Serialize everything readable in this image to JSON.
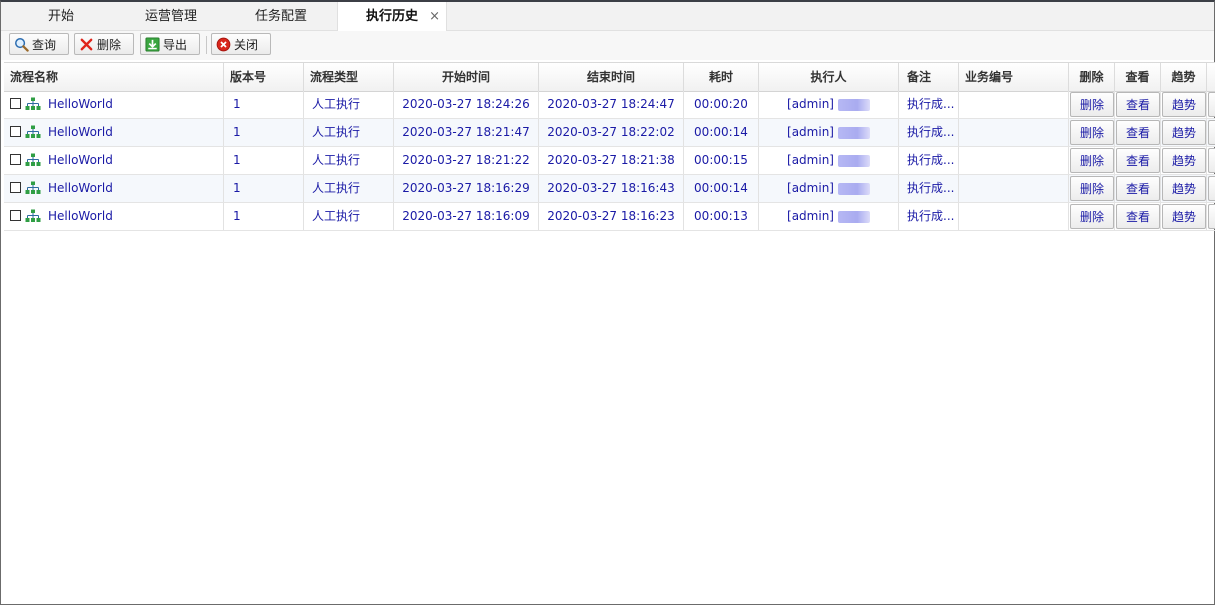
{
  "tabs": [
    {
      "label": "开始"
    },
    {
      "label": "运营管理"
    },
    {
      "label": "任务配置"
    },
    {
      "label": "执行历史",
      "close": "×"
    }
  ],
  "toolbar": {
    "query": "查询",
    "delete": "删除",
    "export": "导出",
    "close": "关闭"
  },
  "columns": {
    "name": "流程名称",
    "version": "版本号",
    "type": "流程类型",
    "start": "开始时间",
    "end": "结束时间",
    "duration": "耗时",
    "executor": "执行人",
    "remark": "备注",
    "bizno": "业务编号",
    "delete": "删除",
    "view": "查看",
    "trend": "趋势"
  },
  "rows": [
    {
      "name": "HelloWorld",
      "version": "1",
      "type": "人工执行",
      "start": "2020-03-27 18:24:26",
      "end": "2020-03-27 18:24:47",
      "duration": "00:00:20",
      "executor": "[admin]",
      "remark": "执行成...",
      "bizno": "",
      "delete": "删除",
      "view": "查看",
      "trend": "趋势"
    },
    {
      "name": "HelloWorld",
      "version": "1",
      "type": "人工执行",
      "start": "2020-03-27 18:21:47",
      "end": "2020-03-27 18:22:02",
      "duration": "00:00:14",
      "executor": "[admin]",
      "remark": "执行成...",
      "bizno": "",
      "delete": "删除",
      "view": "查看",
      "trend": "趋势"
    },
    {
      "name": "HelloWorld",
      "version": "1",
      "type": "人工执行",
      "start": "2020-03-27 18:21:22",
      "end": "2020-03-27 18:21:38",
      "duration": "00:00:15",
      "executor": "[admin]",
      "remark": "执行成...",
      "bizno": "",
      "delete": "删除",
      "view": "查看",
      "trend": "趋势"
    },
    {
      "name": "HelloWorld",
      "version": "1",
      "type": "人工执行",
      "start": "2020-03-27 18:16:29",
      "end": "2020-03-27 18:16:43",
      "duration": "00:00:14",
      "executor": "[admin]",
      "remark": "执行成...",
      "bizno": "",
      "delete": "删除",
      "view": "查看",
      "trend": "趋势"
    },
    {
      "name": "HelloWorld",
      "version": "1",
      "type": "人工执行",
      "start": "2020-03-27 18:16:09",
      "end": "2020-03-27 18:16:23",
      "duration": "00:00:13",
      "executor": "[admin]",
      "remark": "执行成...",
      "bizno": "",
      "delete": "删除",
      "view": "查看",
      "trend": "趋势"
    }
  ],
  "colors": {
    "link": "#1a1aa6",
    "alt_row": "#f5f8fc",
    "header_bg": "#f1f1f1",
    "frame": "#3c3f46"
  },
  "icons": {
    "query": "search-icon",
    "delete": "red-x-icon",
    "export": "download-icon",
    "close": "close-circle-icon",
    "row": "org-chart-icon"
  }
}
